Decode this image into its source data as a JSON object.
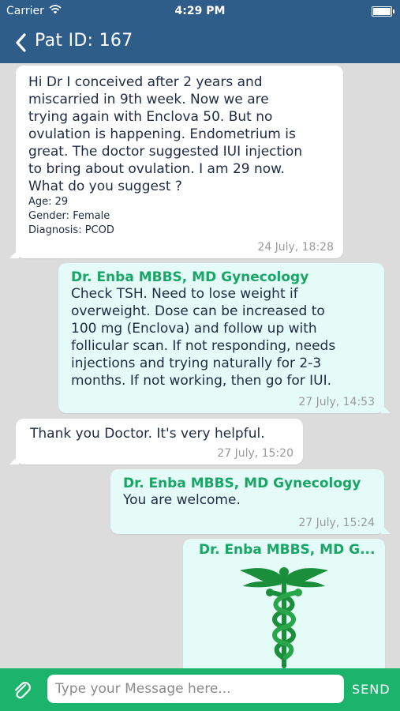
{
  "status_bar": {
    "carrier": "Carrier",
    "time": "4:29 PM"
  },
  "nav": {
    "title": "Pat ID: 167"
  },
  "messages": [
    {
      "direction": "in",
      "text_lines": [
        "Hi Dr I conceived after 2 years and",
        "miscarried in 9th week. Now we are",
        "trying again with Enclova 50. But no",
        "ovulation is happening. Endometrium is",
        "great. The doctor suggested IUI injection",
        "to bring about ovulation. I am 29 now.",
        "What do you suggest ?"
      ],
      "age": "Age: 29",
      "gender": "Gender: Female",
      "diagnosis": "Diagnosis: PCOD",
      "timestamp": "24 July, 18:28"
    },
    {
      "direction": "out",
      "sender": "Dr. Enba MBBS, MD Gynecology",
      "text_lines": [
        "Check TSH. Need to lose weight if",
        "overweight. Dose can be increased to",
        "100 mg (Enclova) and follow up with",
        "follicular scan. If not responding, needs",
        "injections and trying naturally for 2-3",
        "months. If not working, then go for IUI."
      ],
      "timestamp": "27 July, 14:53"
    },
    {
      "direction": "in",
      "text": "Thank you Doctor. It's very helpful.",
      "timestamp": "27 July, 15:20"
    },
    {
      "direction": "out",
      "sender": "Dr. Enba MBBS, MD Gynecology",
      "text": "You are welcome.",
      "timestamp": "27 July, 15:24"
    },
    {
      "direction": "out",
      "sender": "Dr. Enba MBBS, MD G...",
      "image": "caduceus-logo"
    }
  ],
  "composer": {
    "placeholder": "Type your Message here...",
    "send_label": "SEND"
  },
  "colors": {
    "header": "#2e5d8a",
    "accent_green": "#1cb46d",
    "sender_green": "#1aa566",
    "incoming_bubble": "#ffffff",
    "outgoing_bubble": "#e4fbf8"
  },
  "icons": [
    "wifi-icon",
    "battery-icon",
    "back-chevron-icon",
    "paperclip-icon"
  ]
}
